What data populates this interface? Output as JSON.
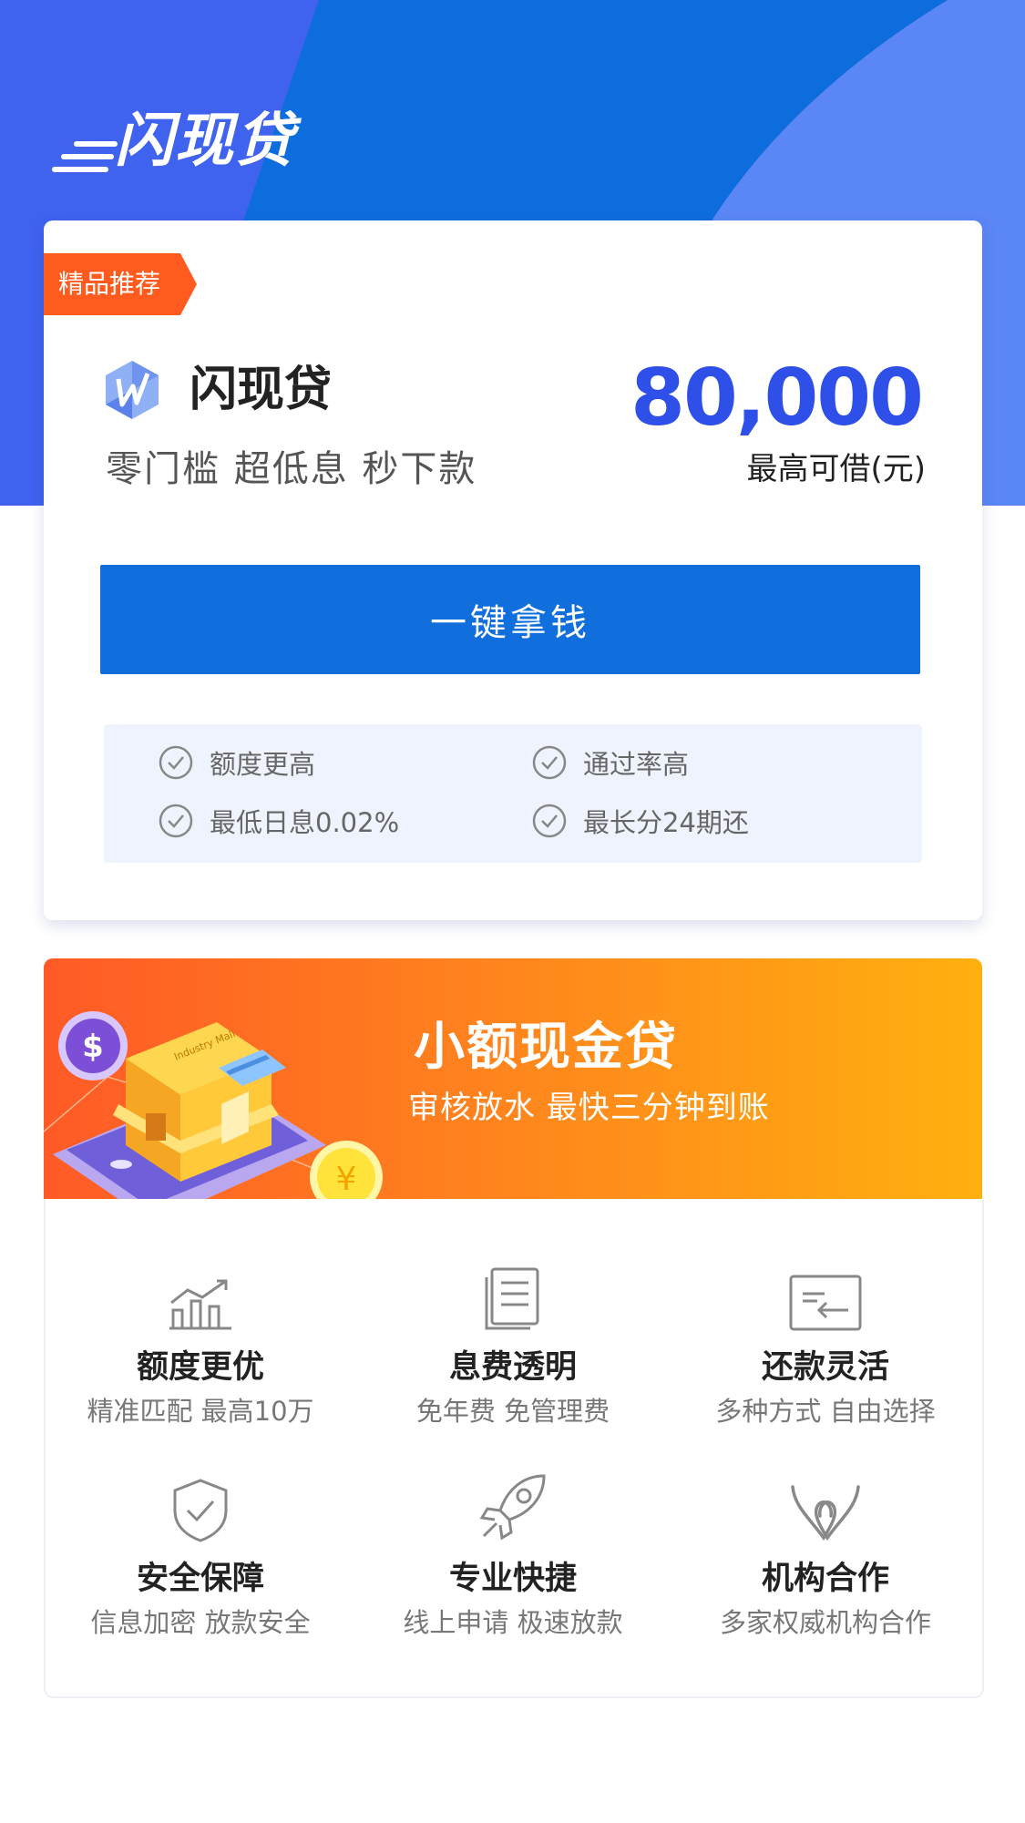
{
  "colors": {
    "primary": "#106fdc",
    "hero_blue": "#3f62ef",
    "accent_orange": "#ff5b1e",
    "amount_blue": "#2e4fe8"
  },
  "brand": {
    "logo_text": "闪现贷"
  },
  "product": {
    "badge": "精品推荐",
    "name": "闪现贷",
    "slogan": "零门槛 超低息 秒下款",
    "amount": "80,000",
    "amount_label": "最高可借(元)",
    "cta_label": "一键拿钱",
    "features": [
      "额度更高",
      "通过率高",
      "最低日息0.02%",
      "最长分24期还"
    ]
  },
  "promo": {
    "title": "小额现金贷",
    "subtitle": "审核放水 最快三分钟到账",
    "art_labels": {
      "dollar": "$",
      "yen": "¥",
      "shop_sign": "Industry Mall"
    }
  },
  "benefits": [
    {
      "icon": "chart-up-icon",
      "title": "额度更优",
      "desc": "精准匹配 最高10万"
    },
    {
      "icon": "document-icon",
      "title": "息费透明",
      "desc": "免年费 免管理费"
    },
    {
      "icon": "repay-icon",
      "title": "还款灵活",
      "desc": "多种方式 自由选择"
    },
    {
      "icon": "shield-check-icon",
      "title": "安全保障",
      "desc": "信息加密 放款安全"
    },
    {
      "icon": "rocket-icon",
      "title": "专业快捷",
      "desc": "线上申请 极速放款"
    },
    {
      "icon": "partnership-icon",
      "title": "机构合作",
      "desc": "多家权威机构合作"
    }
  ]
}
